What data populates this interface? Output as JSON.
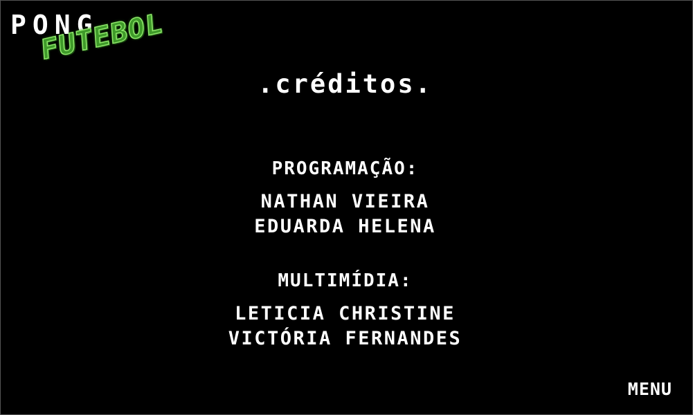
{
  "logo": {
    "line1": "PONG",
    "line2": "FUTEBOL"
  },
  "screen_title": ".créditos.",
  "sections": [
    {
      "heading": "PROGRAMAÇÃO:",
      "names": [
        "NATHAN VIEIRA",
        "EDUARDA HELENA"
      ]
    },
    {
      "heading": "MULTIMÍDIA:",
      "names": [
        "LETICIA CHRISTINE",
        "VICTÓRIA FERNANDES"
      ]
    }
  ],
  "menu_button": "MENU",
  "colors": {
    "background": "#000000",
    "text": "#ffffff",
    "logo_green": "#3f9a2a",
    "logo_green_outline": "#8ee86a"
  }
}
